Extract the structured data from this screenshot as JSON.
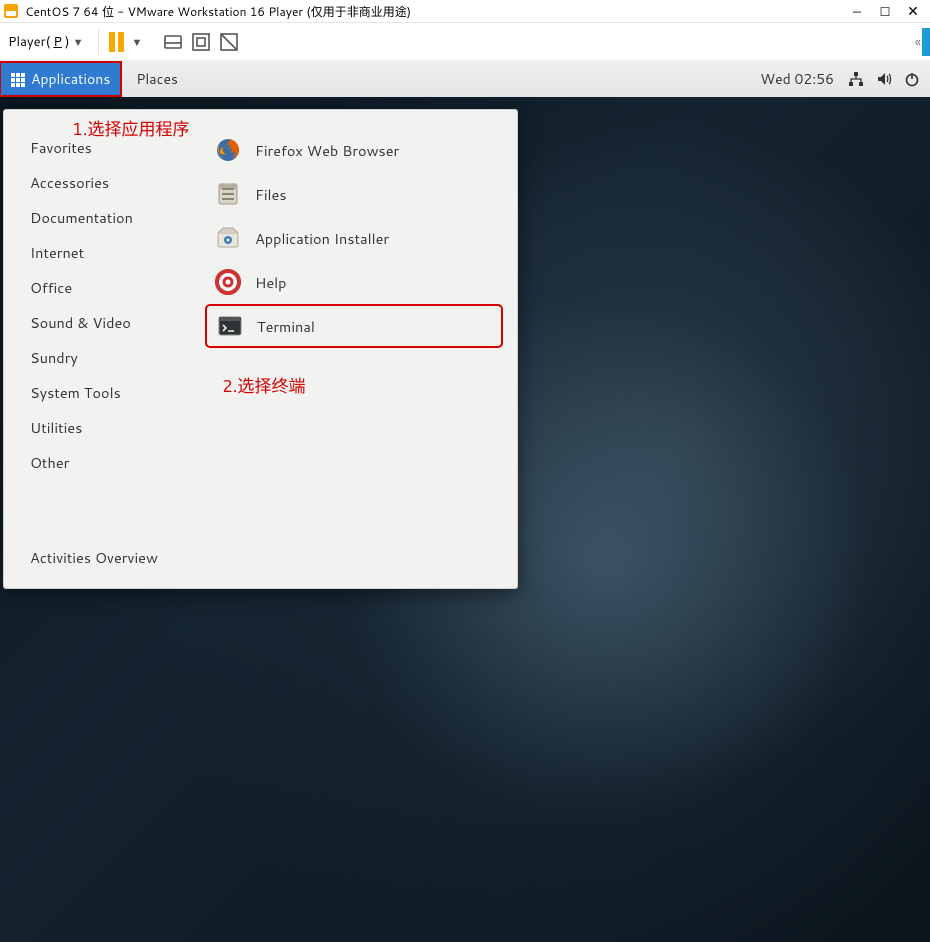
{
  "vmware": {
    "title": "CentOS 7 64 位 - VMware Workstation 16 Player (仅用于非商业用途)",
    "player_menu_prefix": "Player(",
    "player_menu_ul": "P",
    "player_menu_suffix": ")"
  },
  "gnome": {
    "applications": "Applications",
    "places": "Places",
    "clock": "Wed 02:56"
  },
  "menu": {
    "categories": [
      "Favorites",
      "Accessories",
      "Documentation",
      "Internet",
      "Office",
      "Sound & Video",
      "Sundry",
      "System Tools",
      "Utilities",
      "Other"
    ],
    "activities": "Activities Overview",
    "items": [
      {
        "label": "Firefox Web Browser",
        "icon": "firefox"
      },
      {
        "label": "Files",
        "icon": "files"
      },
      {
        "label": "Application Installer",
        "icon": "installer"
      },
      {
        "label": "Help",
        "icon": "help"
      },
      {
        "label": "Terminal",
        "icon": "terminal",
        "highlighted": true
      }
    ]
  },
  "annotations": {
    "a1": "1.选择应用程序",
    "a2": "2.选择终端"
  }
}
